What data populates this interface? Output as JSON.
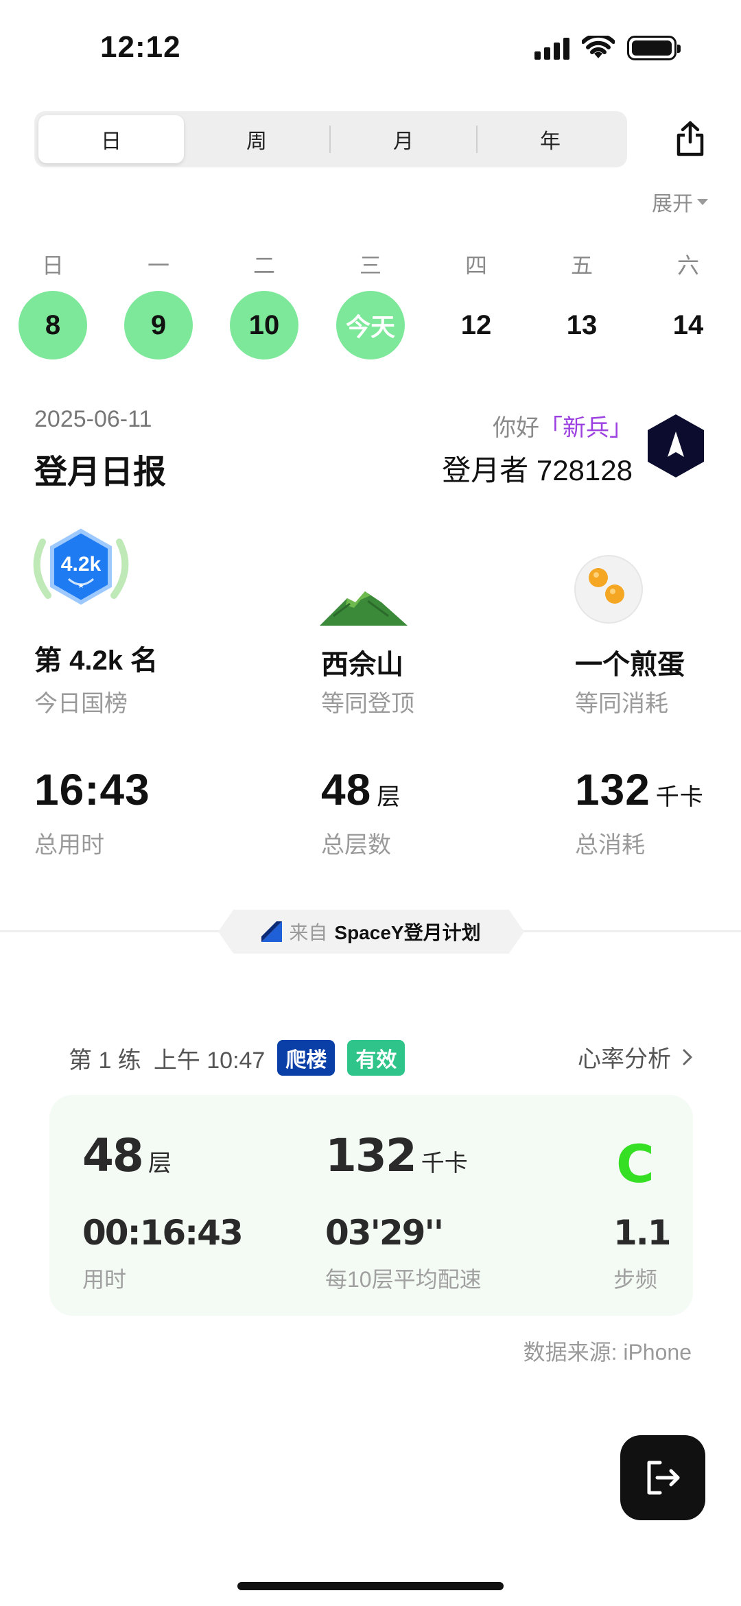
{
  "status_bar": {
    "time": "12:12"
  },
  "tabs": [
    {
      "label": "日",
      "active": true
    },
    {
      "label": "周",
      "active": false
    },
    {
      "label": "月",
      "active": false
    },
    {
      "label": "年",
      "active": false
    }
  ],
  "expand_label": "展开",
  "week": {
    "weekdays": [
      "日",
      "一",
      "二",
      "三",
      "四",
      "五",
      "六"
    ],
    "days": [
      {
        "label": "8",
        "done": true
      },
      {
        "label": "9",
        "done": true
      },
      {
        "label": "10",
        "done": true
      },
      {
        "label": "今天",
        "done": true
      },
      {
        "label": "12",
        "done": false
      },
      {
        "label": "13",
        "done": false
      },
      {
        "label": "14",
        "done": false
      }
    ]
  },
  "report": {
    "date": "2025-06-11",
    "title": "登月日报",
    "greeting_prefix": "你好",
    "rank_name": "「新兵」",
    "climber_label": "登月者",
    "climber_id": "728128"
  },
  "highlights": [
    {
      "badge_text": "4.2k",
      "value": "第 4.2k 名",
      "label": "今日国榜"
    },
    {
      "value": "西佘山",
      "label": "等同登顶"
    },
    {
      "value": "一个煎蛋",
      "label": "等同消耗"
    }
  ],
  "totals": [
    {
      "value": "16:43",
      "unit": "",
      "label": "总用时"
    },
    {
      "value": "48",
      "unit": "层",
      "label": "总层数"
    },
    {
      "value": "132",
      "unit": "千卡",
      "label": "总消耗"
    }
  ],
  "source_pill": {
    "from": "来自",
    "brand": "SpaceY登月计划"
  },
  "session": {
    "index_label": "第 1 练",
    "time": "上午 10:47",
    "tags": [
      {
        "label": "爬楼",
        "color": "#0a3fa8"
      },
      {
        "label": "有效",
        "color": "#2ec48a"
      }
    ],
    "heart_rate_link": "心率分析",
    "floors": "48",
    "floors_unit": "层",
    "calories": "132",
    "calories_unit": "千卡",
    "grade": "C",
    "duration": "00:16:43",
    "duration_label": "用时",
    "pace": "03'29''",
    "pace_label": "每10层平均配速",
    "cadence": "1.1",
    "cadence_label": "步频"
  },
  "data_source": "数据来源: iPhone",
  "colors": {
    "done_day": "#7ee89a",
    "grade": "#35e024",
    "rank": "#9b3fe0"
  }
}
